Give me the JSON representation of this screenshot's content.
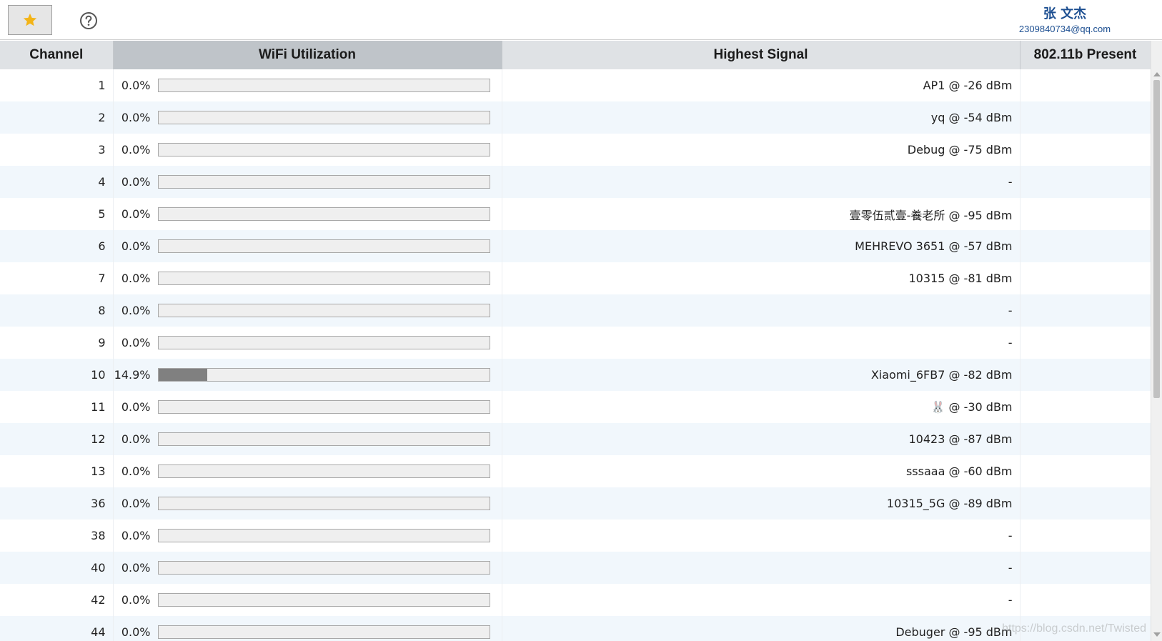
{
  "header": {
    "user_name": "张 文杰",
    "user_email": "2309840734@qq.com",
    "favorite_icon": "star-icon",
    "help_icon": "question-circle-icon"
  },
  "colors": {
    "accent_star": "#f3b417",
    "user_text": "#1d4f91",
    "bar_fill": "#808080",
    "row_alt": "#f1f7fc"
  },
  "table": {
    "columns": [
      "Channel",
      "WiFi Utilization",
      "Highest Signal",
      "802.11b Present"
    ],
    "sorted_column": "WiFi Utilization",
    "rows": [
      {
        "channel": "1",
        "util": "0.0%",
        "util_value": 0.0,
        "signal": "AP1 @ -26 dBm",
        "b": ""
      },
      {
        "channel": "2",
        "util": "0.0%",
        "util_value": 0.0,
        "signal": "yq @ -54 dBm",
        "b": ""
      },
      {
        "channel": "3",
        "util": "0.0%",
        "util_value": 0.0,
        "signal": "Debug @ -75 dBm",
        "b": ""
      },
      {
        "channel": "4",
        "util": "0.0%",
        "util_value": 0.0,
        "signal": "-",
        "b": ""
      },
      {
        "channel": "5",
        "util": "0.0%",
        "util_value": 0.0,
        "signal": "壹零伍贰壹-養老所 @ -95 dBm",
        "b": ""
      },
      {
        "channel": "6",
        "util": "0.0%",
        "util_value": 0.0,
        "signal": "MEHREVO 3651 @ -57 dBm",
        "b": ""
      },
      {
        "channel": "7",
        "util": "0.0%",
        "util_value": 0.0,
        "signal": "10315 @ -81 dBm",
        "b": ""
      },
      {
        "channel": "8",
        "util": "0.0%",
        "util_value": 0.0,
        "signal": "-",
        "b": ""
      },
      {
        "channel": "9",
        "util": "0.0%",
        "util_value": 0.0,
        "signal": "-",
        "b": ""
      },
      {
        "channel": "10",
        "util": "14.9%",
        "util_value": 14.9,
        "signal": "Xiaomi_6FB7 @ -82 dBm",
        "b": ""
      },
      {
        "channel": "11",
        "util": "0.0%",
        "util_value": 0.0,
        "signal": "🐰 @ -30 dBm",
        "b": ""
      },
      {
        "channel": "12",
        "util": "0.0%",
        "util_value": 0.0,
        "signal": "10423 @ -87 dBm",
        "b": ""
      },
      {
        "channel": "13",
        "util": "0.0%",
        "util_value": 0.0,
        "signal": "sssaaa @ -60 dBm",
        "b": ""
      },
      {
        "channel": "36",
        "util": "0.0%",
        "util_value": 0.0,
        "signal": "10315_5G @ -89 dBm",
        "b": ""
      },
      {
        "channel": "38",
        "util": "0.0%",
        "util_value": 0.0,
        "signal": "-",
        "b": ""
      },
      {
        "channel": "40",
        "util": "0.0%",
        "util_value": 0.0,
        "signal": "-",
        "b": ""
      },
      {
        "channel": "42",
        "util": "0.0%",
        "util_value": 0.0,
        "signal": "-",
        "b": ""
      },
      {
        "channel": "44",
        "util": "0.0%",
        "util_value": 0.0,
        "signal": "Debuger @ -95 dBm",
        "b": ""
      }
    ]
  },
  "watermark": "https://blog.csdn.net/Twisted"
}
